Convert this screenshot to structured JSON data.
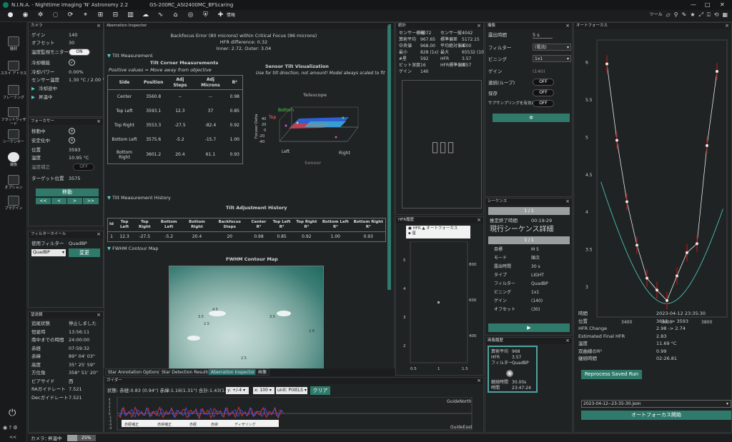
{
  "title": "N.I.N.A. - Nighttime Imaging 'N' Astronomy 2.2",
  "profile": "GS-200RC_ASI2400MC_BFScaring",
  "window_controls": [
    "—",
    "□",
    "✕"
  ],
  "toolbar": {
    "info": "情報",
    "tools_label": "ツール"
  },
  "leftnav": {
    "items": [
      "機材",
      "スカイ アトラス",
      "フレーミング",
      "フラットウィザード",
      "シーケンサー",
      "撮像",
      "オプション",
      "プラグイン"
    ]
  },
  "camera": {
    "header": "カメラ",
    "fields": [
      {
        "k": "ゲイン",
        "v": "140"
      },
      {
        "k": "オフセット",
        "v": "30"
      },
      {
        "k": "温度制御",
        "v": ""
      },
      {
        "k": "冷却機能",
        "v": ""
      },
      {
        "k": "冷却パワー",
        "v": "0.00%"
      },
      {
        "k": "センサー温度",
        "v": "1.30 °C / 2.00 °C"
      }
    ],
    "usb_monitor": "温度監視モニター",
    "usb_state": "ON",
    "cooling_label": "冷却途中",
    "warming_label": "昇温中"
  },
  "focuser": {
    "header": "フォーカサー",
    "fields": [
      {
        "k": "移動中",
        "v": ""
      },
      {
        "k": "安定化中",
        "v": ""
      },
      {
        "k": "位置",
        "v": "3593"
      },
      {
        "k": "温度",
        "v": "10.95 °C"
      },
      {
        "k": "温度補正",
        "v": "OFF"
      },
      {
        "k": "ターゲット位置",
        "v": "3575"
      }
    ],
    "move_label": "移動",
    "arrows": [
      "<<",
      "<",
      ">",
      ">>"
    ]
  },
  "filterwheel": {
    "header": "フィルターホイール",
    "using": "使用フィルター",
    "current": "QuadBP",
    "selected": "QuadBP",
    "change": "変更"
  },
  "weather": {
    "header": "望遠鏡",
    "fields": [
      {
        "k": "追尾状態",
        "v": "停止しました"
      },
      {
        "k": "恒星時",
        "v": "13:56:11"
      },
      {
        "k": "南中までの時間",
        "v": "24:00:00"
      },
      {
        "k": "赤経",
        "v": "07:59:32"
      },
      {
        "k": "赤緯",
        "v": "89° 04' 03\""
      },
      {
        "k": "高度",
        "v": "35° 25' 59\""
      },
      {
        "k": "方位角",
        "v": "358° 51' 20\""
      },
      {
        "k": "ピアサイド",
        "v": "西"
      },
      {
        "k": "RAガイドレート",
        "v": "7.521"
      },
      {
        "k": "Decガイドレート",
        "v": "7.521"
      }
    ]
  },
  "statusbar": {
    "camera": "カメラ：",
    "state": "昇温中",
    "percent": "25%"
  },
  "aberration": {
    "header": "Aberration Inspector",
    "summary1": "Backfocus Error (80 microns) within Critical Focus (86 microns)",
    "summary2": "HFR difference: 0.32",
    "summary3": "Inner: 2.72, Outer: 3.04",
    "tilt_section": "Tilt Measurement",
    "tilt_title": "Tilt Corner Measurements",
    "tilt_sub": "Positive values = Move away from objective",
    "columns": [
      "Side",
      "Position",
      "Adj Steps",
      "Adj Microns",
      "R²"
    ],
    "rows": [
      [
        "Center",
        "3560.8",
        "--",
        "--",
        "0.98"
      ],
      [
        "Top Left",
        "3593.1",
        "12.3",
        "37",
        "0.85"
      ],
      [
        "Top Right",
        "3553.3",
        "-27.5",
        "-82.4",
        "0.92"
      ],
      [
        "Bottom Left",
        "3575.6",
        "-5.2",
        "-15.7",
        "1.00"
      ],
      [
        "Bottom Right",
        "3601.2",
        "20.4",
        "61.1",
        "0.93"
      ]
    ],
    "viz_title": "Sensor Tilt Visualization",
    "viz_sub": "Use for tilt direction, not amount! Model always scaled to fit",
    "viz_axes": {
      "telescope": "Telescope",
      "bottom": "Bottom",
      "top": "Top",
      "left": "Left",
      "right": "Right",
      "z": "Focuser Delta",
      "sensor": "Sensor"
    },
    "viz_ticks": [
      "40",
      "20",
      "0",
      "-20",
      "-40"
    ],
    "history_section": "Tilt Measurement History",
    "history_title": "Tilt Adjustment History",
    "history_cols": [
      "Id",
      "Top Left",
      "Top Right",
      "Bottom Left",
      "Bottom Right",
      "Backfocus Steps",
      "Center R²",
      "Top Left R²",
      "Top Right R²",
      "Bottom Left R²",
      "Bottom Right R²"
    ],
    "history_row": [
      "1",
      "12.3",
      "-27.5",
      "-5.2",
      "20.4",
      "20",
      "0.98",
      "0.85",
      "0.92",
      "1.00",
      "0.93"
    ],
    "fwhm_section": "FWHM Contour Map",
    "fwhm_title": "FWHM Contour Map",
    "contour_labels": [
      "4.5",
      "3.5",
      "3.5",
      "2.5",
      "2.5",
      "2.8"
    ],
    "tabs": [
      "Star Annotation Options",
      "Star Detection Results",
      "Aberration Inspector",
      "画像"
    ],
    "active_tab": 2
  },
  "stats": {
    "header": "統計",
    "fields": [
      {
        "k": "センサー横幅",
        "v": "6072",
        "k2": "センサー縦",
        "v2": "4042"
      },
      {
        "k": "算術平均",
        "v": "967.65",
        "k2": "標準偏差",
        "v2": "5172.15"
      },
      {
        "k": "中央値",
        "v": "968.00",
        "k2": "平均絶対偏差",
        "v2": "4.00"
      },
      {
        "k": "最小",
        "v": "828 (1x)",
        "k2": "最大",
        "v2": "65532 (10"
      },
      {
        "k": "#星",
        "v": "592",
        "k2": "HFR",
        "v2": "3.57"
      },
      {
        "k": "ビット深度",
        "v": "16",
        "k2": "HFR標準偏差",
        "v2": "0.57"
      },
      {
        "k": "ゲイン",
        "v": "140",
        "k2": "",
        "v2": ""
      }
    ]
  },
  "hfr": {
    "header": "HFR履歴",
    "legend": [
      "HFR",
      "オートフォーカス",
      "星"
    ],
    "yleft": [
      "5",
      "4",
      "3",
      "2",
      "1"
    ],
    "yright": [
      "800",
      "600",
      "400",
      "200"
    ],
    "x": [
      "0.5",
      "1",
      "1.5"
    ]
  },
  "imaging": {
    "header": "撮像",
    "fields": [
      {
        "k": "露出時間",
        "v": "5"
      },
      {
        "k": "フィルター",
        "v": "(電流)"
      },
      {
        "k": "ビニング",
        "v": "1x1"
      },
      {
        "k": "ゲイン",
        "v": "(140)"
      },
      {
        "k": "連続(ループ)",
        "v": "OFF"
      },
      {
        "k": "保存",
        "v": "OFF"
      },
      {
        "k": "サブサンプリングを有効に",
        "v": "OFF"
      }
    ],
    "unit": "s"
  },
  "sequence": {
    "header": "シーケンス",
    "progress": "1 / 1",
    "eta_label": "推定終了時間",
    "eta": "00:19:29",
    "detail": "現行シーケンス詳細",
    "progress2": "1 / 1",
    "fields": [
      {
        "k": "目標",
        "v": "M 5"
      },
      {
        "k": "モード",
        "v": "順次"
      },
      {
        "k": "露出時間",
        "v": "30 s"
      },
      {
        "k": "タイプ",
        "v": "LIGHT"
      },
      {
        "k": "フィルター",
        "v": "QuadBP"
      },
      {
        "k": "ビニング",
        "v": "1x1"
      },
      {
        "k": "ゲイン",
        "v": "(140)"
      },
      {
        "k": "オフセット",
        "v": "(30)"
      }
    ]
  },
  "history": {
    "header": "画像履歴",
    "fields": [
      {
        "k": "算術平均",
        "v": "968"
      },
      {
        "k": "HFR",
        "v": "3.57"
      },
      {
        "k": "フィルター",
        "v": "QuadBP"
      }
    ],
    "dur_label": "継続時間",
    "dur": "30.00s",
    "time_label": "時間",
    "time": "23:47:24"
  },
  "autofocus": {
    "header": "オートフォーカス",
    "y_ticks": [
      "6",
      "5.5",
      "5",
      "4.5",
      "4",
      "3.5",
      "3"
    ],
    "x_ticks": [
      "3400",
      "3600",
      "3800"
    ],
    "fields": [
      {
        "k": "時間",
        "v": "2023-04-12 23:35:30"
      },
      {
        "k": "位置",
        "v": "3611 -> 3593"
      },
      {
        "k": "HFR Change",
        "v": "2.98 -> 2.74"
      },
      {
        "k": "Estimated Final HFR",
        "v": "2.83"
      },
      {
        "k": "温度",
        "v": "11.69 °C"
      },
      {
        "k": "双曲線のR²",
        "v": "0.99"
      },
      {
        "k": "継続時間",
        "v": "02:26.81"
      }
    ],
    "reprocess": "Reprocess Saved Run",
    "file": "2023-04-12--23-35-30.json",
    "start": "オートフォーカス開始",
    "points": [
      {
        "x": 3300,
        "y": 5.98
      },
      {
        "x": 3350,
        "y": 4.96
      },
      {
        "x": 3400,
        "y": 4.14
      },
      {
        "x": 3450,
        "y": 3.56
      },
      {
        "x": 3500,
        "y": 3.12
      },
      {
        "x": 3550,
        "y": 2.96
      },
      {
        "x": 3600,
        "y": 2.82
      },
      {
        "x": 3650,
        "y": 3.15
      },
      {
        "x": 3700,
        "y": 3.46
      },
      {
        "x": 3750,
        "y": 3.58
      },
      {
        "x": 3800,
        "y": 4.89
      },
      {
        "x": 3850,
        "y": 5.88
      }
    ]
  },
  "guider": {
    "header": "ガイダー",
    "status": "状態: 赤経:0.83 (0.94\") 赤緯:1.16(1.31\") 合計:1.43(1.61\")",
    "yaxis": "y: +/-4",
    "xaxis": "x: 100",
    "unit": "unit: PIXELS",
    "clear": "クリア",
    "north": "GuideNorth",
    "east": "GuideEast",
    "legend": [
      "赤経補正",
      "赤緯補正",
      "赤経",
      "赤緯",
      "ディザリング"
    ],
    "ticks": [
      "4",
      "3",
      "2",
      "1",
      "0",
      "-1",
      "-2",
      "-3",
      "-4"
    ]
  },
  "colors": {
    "accent": "#2f7a6b",
    "bg": "#202324",
    "ra": "#ff3030",
    "dec": "#3355ff",
    "curve": "#e8e8e8"
  }
}
